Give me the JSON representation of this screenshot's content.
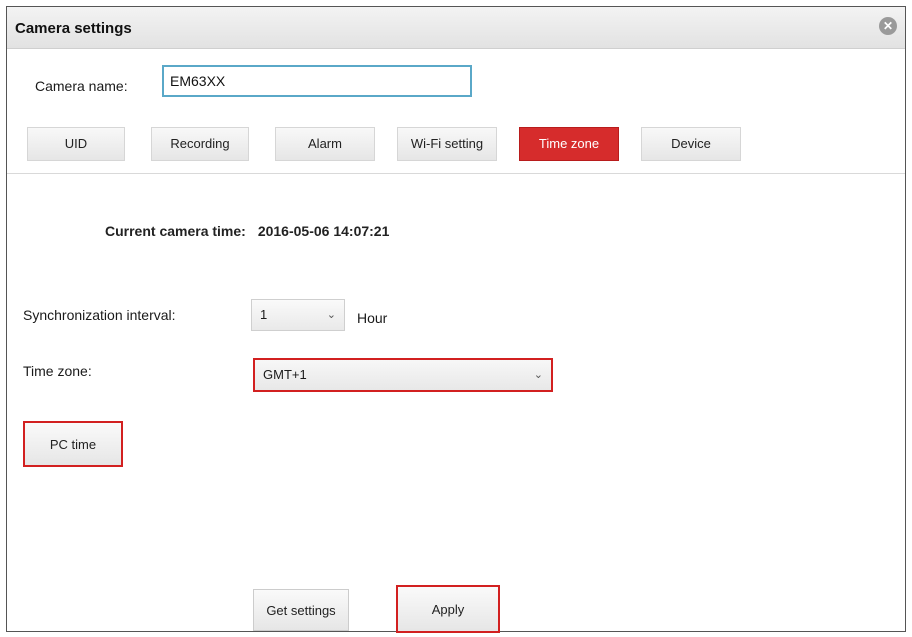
{
  "window": {
    "title": "Camera settings",
    "close_symbol": "✕"
  },
  "camera_name": {
    "label": "Camera name:",
    "value": "EM63XX"
  },
  "tabs": [
    {
      "label": "UID",
      "active": false
    },
    {
      "label": "Recording",
      "active": false
    },
    {
      "label": "Alarm",
      "active": false
    },
    {
      "label": "Wi-Fi setting",
      "active": false
    },
    {
      "label": "Time zone",
      "active": true
    },
    {
      "label": "Device",
      "active": false
    }
  ],
  "time_zone_panel": {
    "current_time_label": "Current camera time:",
    "current_time_value": "2016-05-06 14:07:21",
    "sync_interval_label": "Synchronization interval:",
    "sync_interval_value": "1",
    "sync_interval_unit": "Hour",
    "time_zone_label": "Time zone:",
    "time_zone_value": "GMT+1",
    "pc_time_button": "PC time"
  },
  "footer": {
    "get_settings_button": "Get settings",
    "apply_button": "Apply"
  },
  "colors": {
    "active_tab": "#d62c2c",
    "highlight_border": "#d22020",
    "input_border": "#5aa8c8"
  },
  "icons": {
    "close": "close-icon",
    "dropdown": "chevron-down-icon"
  }
}
